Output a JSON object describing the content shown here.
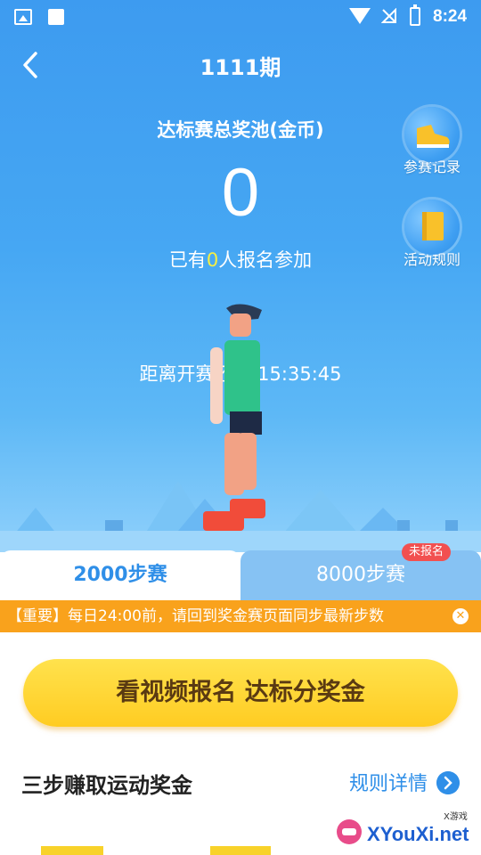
{
  "status_bar": {
    "time": "8:24"
  },
  "header": {
    "title": "1111期"
  },
  "pool": {
    "label": "达标赛总奖池(金币)",
    "value": "0"
  },
  "joined": {
    "prefix": "已有",
    "count": "0",
    "suffix": "人报名参加"
  },
  "side_buttons": [
    {
      "label": "参赛记录",
      "icon": "sneaker-icon"
    },
    {
      "label": "活动规则",
      "icon": "rulebook-icon"
    }
  ],
  "countdown": {
    "text": "距离开赛还有 15:35:45"
  },
  "tabs": [
    {
      "label": "2000步赛",
      "active": true
    },
    {
      "label": "8000步赛",
      "active": false,
      "badge": "未报名"
    }
  ],
  "notice": {
    "text": "【重要】每日24:00前，请回到奖金赛页面同步最新步数"
  },
  "cta": {
    "label": "看视频报名 达标分奖金"
  },
  "section": {
    "title": "三步赚取运动奖金",
    "link": "规则详情"
  },
  "watermark": {
    "text": "XYouXi.net",
    "sub": "X游戏"
  },
  "colors": {
    "primary": "#3d9bf0",
    "accent": "#ffcc22",
    "notice": "#f9a21c",
    "badge": "#f25050"
  }
}
